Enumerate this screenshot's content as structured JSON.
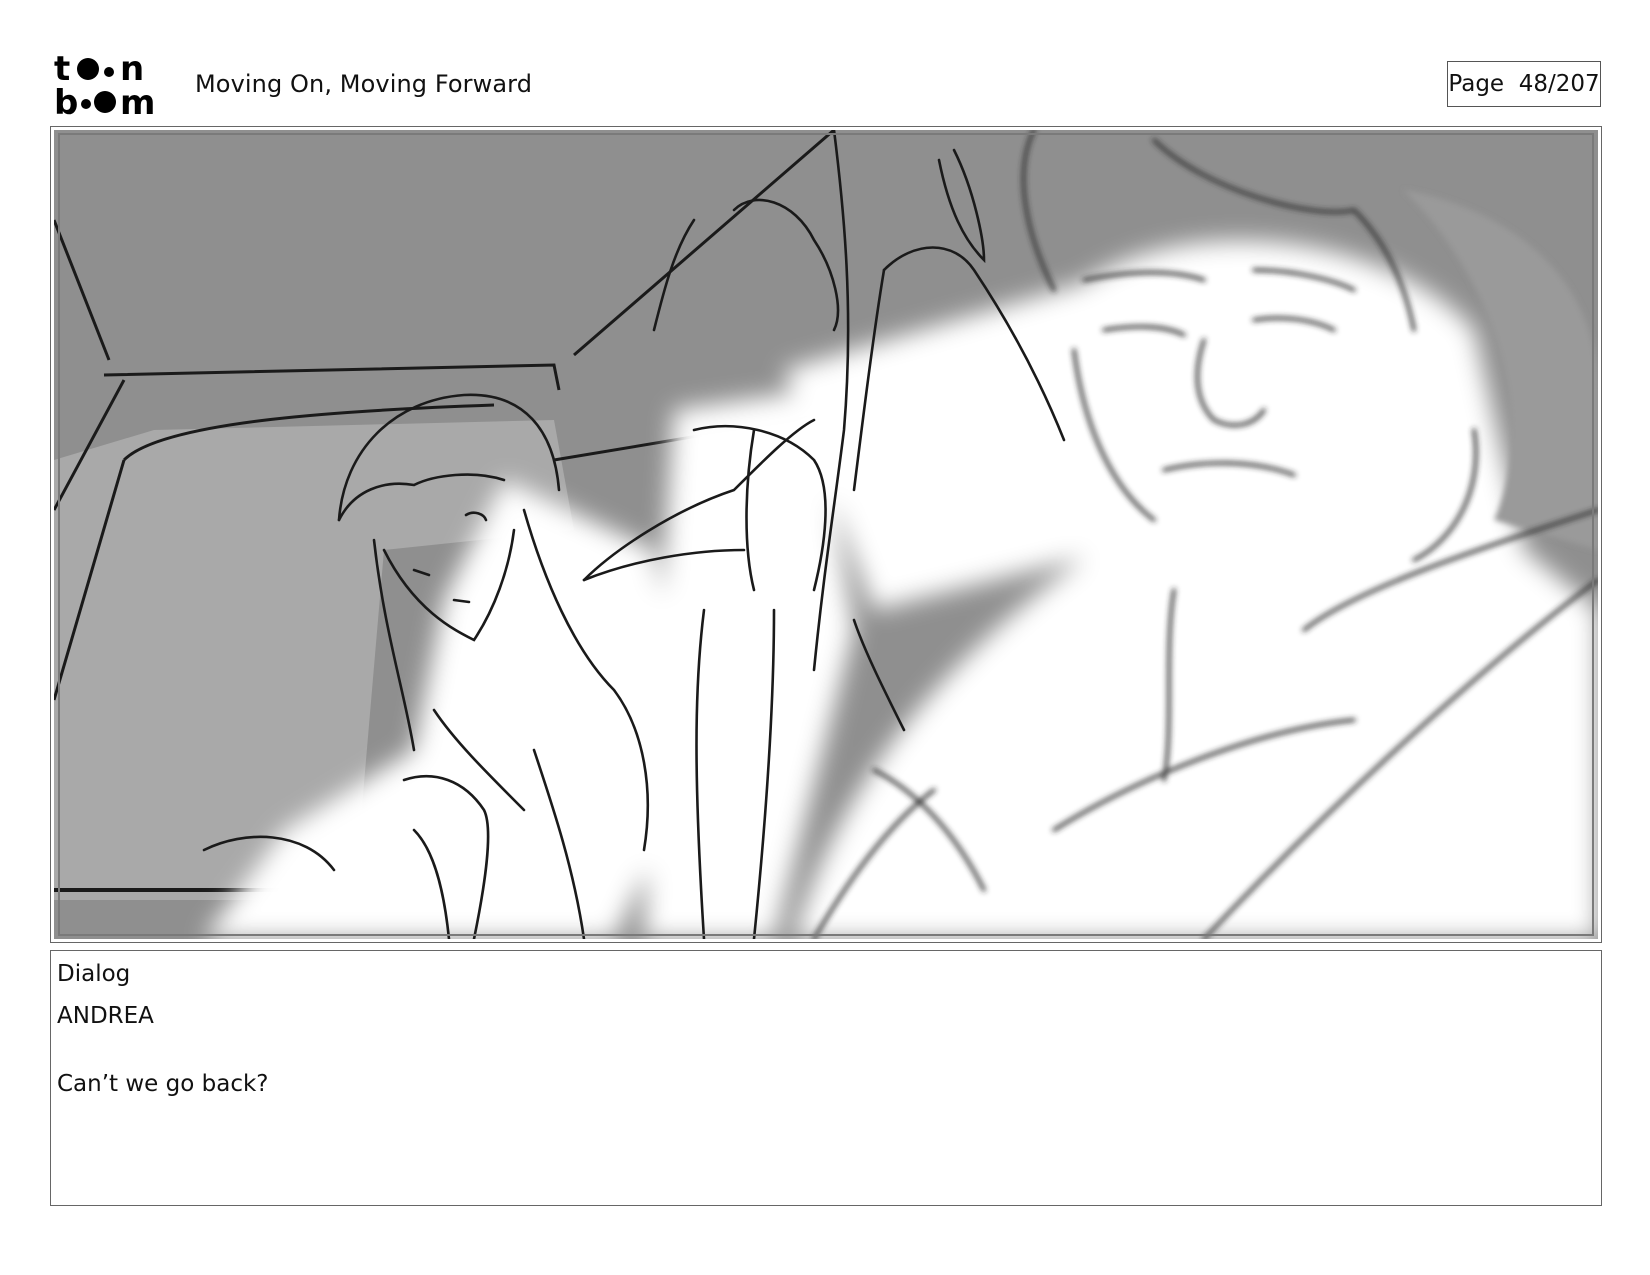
{
  "header": {
    "logo_text": "toonboom",
    "project_title": "Moving On, Moving Forward",
    "page_indicator": "Page  48/207"
  },
  "panel": {
    "scene": "storyboard-sketch-car-interior",
    "colors": {
      "background": "#8f8f8f",
      "window": "#a9a9a9",
      "highlight": "#ffffff",
      "line": "#1a1a1a"
    }
  },
  "dialog": {
    "label": "Dialog",
    "character": "ANDREA",
    "line": "Can’t we go back?"
  }
}
